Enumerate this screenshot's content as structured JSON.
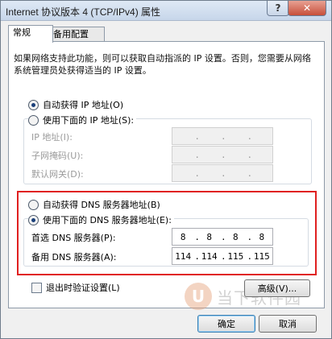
{
  "window": {
    "title": "Internet 协议版本 4 (TCP/IPv4) 属性",
    "help_label": "?",
    "close_label": "✕"
  },
  "tabs": [
    {
      "label": "常规",
      "active": true
    },
    {
      "label": "备用配置",
      "active": false
    }
  ],
  "description": "如果网络支持此功能，则可以获取自动指派的 IP 设置。否则，您需要从网络系统管理员处获得适当的 IP 设置。",
  "ip_section": {
    "auto_label": "自动获得 IP 地址(O)",
    "manual_label": "使用下面的 IP 地址(S):",
    "selected": "auto",
    "fields": [
      {
        "label": "IP 地址(I):",
        "value": [
          "",
          "",
          "",
          ""
        ]
      },
      {
        "label": "子网掩码(U):",
        "value": [
          "",
          "",
          "",
          ""
        ]
      },
      {
        "label": "默认网关(D):",
        "value": [
          "",
          "",
          "",
          ""
        ]
      }
    ]
  },
  "dns_section": {
    "auto_label": "自动获得 DNS 服务器地址(B)",
    "manual_label": "使用下面的 DNS 服务器地址(E):",
    "selected": "manual",
    "fields": [
      {
        "label": "首选 DNS 服务器(P):",
        "value": [
          "8",
          "8",
          "8",
          "8"
        ]
      },
      {
        "label": "备用 DNS 服务器(A):",
        "value": [
          "114",
          "114",
          "115",
          "115"
        ]
      }
    ],
    "highlight_color": "#e02020"
  },
  "validate_checkbox": {
    "label": "退出时验证设置(L)",
    "checked": false
  },
  "advanced_button": "高级(V)...",
  "ok_button": "确定",
  "cancel_button": "取消",
  "watermark": {
    "glyph": "U",
    "text": "当下软件园"
  }
}
